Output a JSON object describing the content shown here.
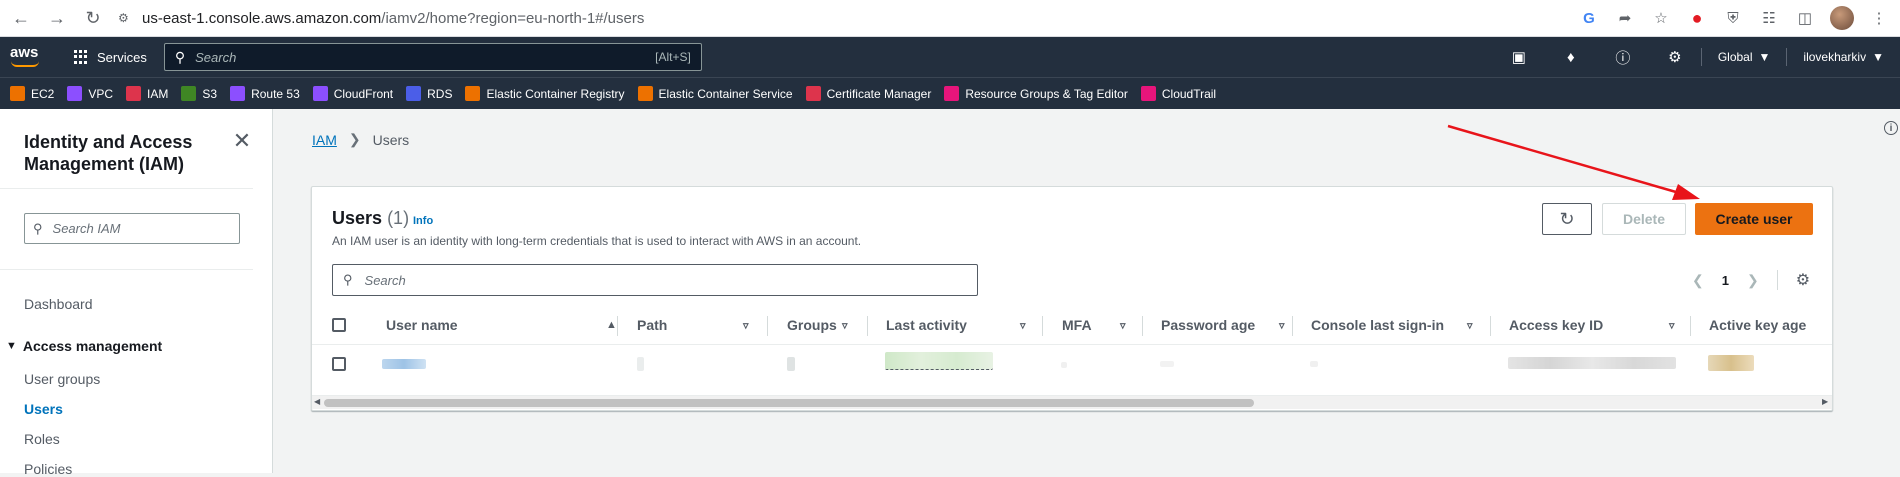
{
  "browser": {
    "url_host": "us-east-1.console.aws.amazon.com",
    "url_path": "/iamv2/home?region=eu-north-1#/users"
  },
  "topnav": {
    "logo_text": "aws",
    "services_label": "Services",
    "search_placeholder": "Search",
    "search_shortcut": "[Alt+S]",
    "region_label": "Global",
    "account_label": "ilovekharkiv"
  },
  "favorites": [
    {
      "label": "EC2",
      "color": "#ed7100"
    },
    {
      "label": "VPC",
      "color": "#8c4fff"
    },
    {
      "label": "IAM",
      "color": "#dd344c"
    },
    {
      "label": "S3",
      "color": "#3f8624"
    },
    {
      "label": "Route 53",
      "color": "#8c4fff"
    },
    {
      "label": "CloudFront",
      "color": "#8c4fff"
    },
    {
      "label": "RDS",
      "color": "#4b5ee8"
    },
    {
      "label": "Elastic Container Registry",
      "color": "#ed7100"
    },
    {
      "label": "Elastic Container Service",
      "color": "#ed7100"
    },
    {
      "label": "Certificate Manager",
      "color": "#dd344c"
    },
    {
      "label": "Resource Groups & Tag Editor",
      "color": "#e7157b"
    },
    {
      "label": "CloudTrail",
      "color": "#e7157b"
    }
  ],
  "sidebar": {
    "title": "Identity and Access Management (IAM)",
    "search_placeholder": "Search IAM",
    "dashboard": "Dashboard",
    "section": "Access management",
    "items": [
      "User groups",
      "Users",
      "Roles",
      "Policies"
    ]
  },
  "breadcrumb": {
    "root": "IAM",
    "current": "Users"
  },
  "panel": {
    "title": "Users",
    "count": "(1)",
    "info": "Info",
    "description": "An IAM user is an identity with long-term credentials that is used to interact with AWS in an account.",
    "delete_label": "Delete",
    "create_label": "Create user",
    "search_placeholder": "Search",
    "page": "1"
  },
  "table": {
    "columns": [
      "User name",
      "Path",
      "Groups",
      "Last activity",
      "MFA",
      "Password age",
      "Console last sign-in",
      "Access key ID",
      "Active key age"
    ]
  },
  "colors": {
    "accent_orange": "#ec7211",
    "link_blue": "#0073bb",
    "nav_dark": "#232f3e",
    "annotation_red": "#e8141a"
  }
}
